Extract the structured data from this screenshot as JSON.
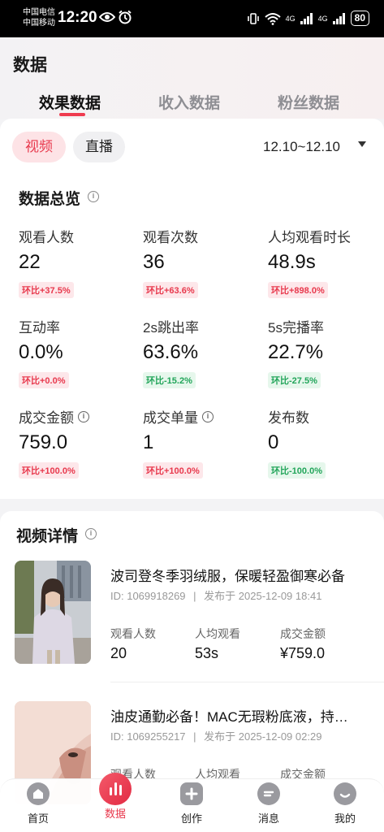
{
  "status_bar": {
    "carrier1": "中国电信",
    "carrier2": "中国移动",
    "time": "12:20",
    "network": "4G",
    "battery": "80"
  },
  "header": {
    "title": "数据",
    "tabs": [
      "效果数据",
      "收入数据",
      "粉丝数据"
    ],
    "active_tab": 0
  },
  "filters": {
    "pills": [
      "视频",
      "直播"
    ],
    "active_pill": 0,
    "date_range": "12.10~12.10"
  },
  "overview": {
    "title": "数据总览",
    "metrics": [
      {
        "label": "观看人数",
        "value": "22",
        "change": "环比+37.5%",
        "trend": "up",
        "info": false
      },
      {
        "label": "观看次数",
        "value": "36",
        "change": "环比+63.6%",
        "trend": "up",
        "info": false
      },
      {
        "label": "人均观看时长",
        "value": "48.9s",
        "change": "环比+898.0%",
        "trend": "up",
        "info": false
      },
      {
        "label": "互动率",
        "value": "0.0%",
        "change": "环比+0.0%",
        "trend": "up",
        "info": false
      },
      {
        "label": "2s跳出率",
        "value": "63.6%",
        "change": "环比-15.2%",
        "trend": "down",
        "info": false
      },
      {
        "label": "5s完播率",
        "value": "22.7%",
        "change": "环比-27.5%",
        "trend": "down",
        "info": false
      },
      {
        "label": "成交金额",
        "value": "759.0",
        "change": "环比+100.0%",
        "trend": "up",
        "info": true
      },
      {
        "label": "成交单量",
        "value": "1",
        "change": "环比+100.0%",
        "trend": "up",
        "info": true
      },
      {
        "label": "发布数",
        "value": "0",
        "change": "环比-100.0%",
        "trend": "down",
        "info": false
      }
    ]
  },
  "details": {
    "title": "视频详情",
    "videos": [
      {
        "title": "波司登冬季羽绒服，保暖轻盈御寒必备",
        "id": "ID:  1069918269",
        "published": "发布于 2025-12-09 18:41",
        "stats": [
          {
            "label": "观看人数",
            "value": "20"
          },
          {
            "label": "人均观看",
            "value": "53s"
          },
          {
            "label": "成交金额",
            "value": "¥759.0"
          }
        ]
      },
      {
        "title": "油皮通勤必备！MAC无瑕粉底液，持…",
        "id": "ID:  1069255217",
        "published": "发布于 2025-12-09 02:29",
        "stats": [
          {
            "label": "观看人数",
            "value": ""
          },
          {
            "label": "人均观看",
            "value": ""
          },
          {
            "label": "成交金额",
            "value": ""
          }
        ]
      }
    ]
  },
  "bottom_nav": {
    "items": [
      "首页",
      "数据",
      "创作",
      "消息",
      "我的"
    ],
    "active": 1
  },
  "colors": {
    "accent": "#e8394d",
    "up": "#e8394d",
    "down": "#22a55a"
  }
}
